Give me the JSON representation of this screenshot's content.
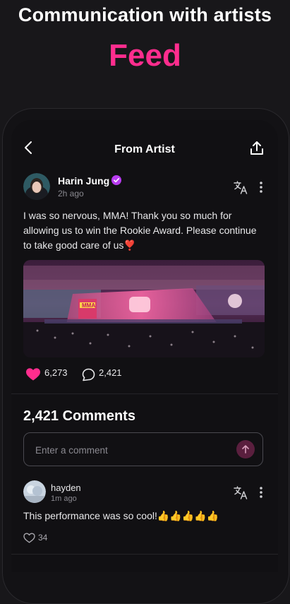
{
  "promo": {
    "title": "Communication with artists",
    "accent": "Feed"
  },
  "colors": {
    "accent": "#ff2d8e",
    "verified": "#b83cf0",
    "heart": "#ff2d8e"
  },
  "header": {
    "title": "From Artist",
    "back_icon": "chevron-left-icon",
    "share_icon": "share-icon"
  },
  "post": {
    "author": "Harin Jung",
    "time": "2h ago",
    "text": "I was so nervous, MMA! Thank you so much for allowing us to win the Rookie Award. Please continue to take good care of us❣️",
    "image_sign": "MMA",
    "likes": "6,273",
    "comments": "2,421"
  },
  "comments_section": {
    "heading": "2,421 Comments",
    "input_placeholder": "Enter a comment",
    "items": [
      {
        "user": "hayden",
        "time": "1m ago",
        "text": "This performance was so cool!👍👍👍👍👍",
        "likes": "34"
      }
    ]
  }
}
